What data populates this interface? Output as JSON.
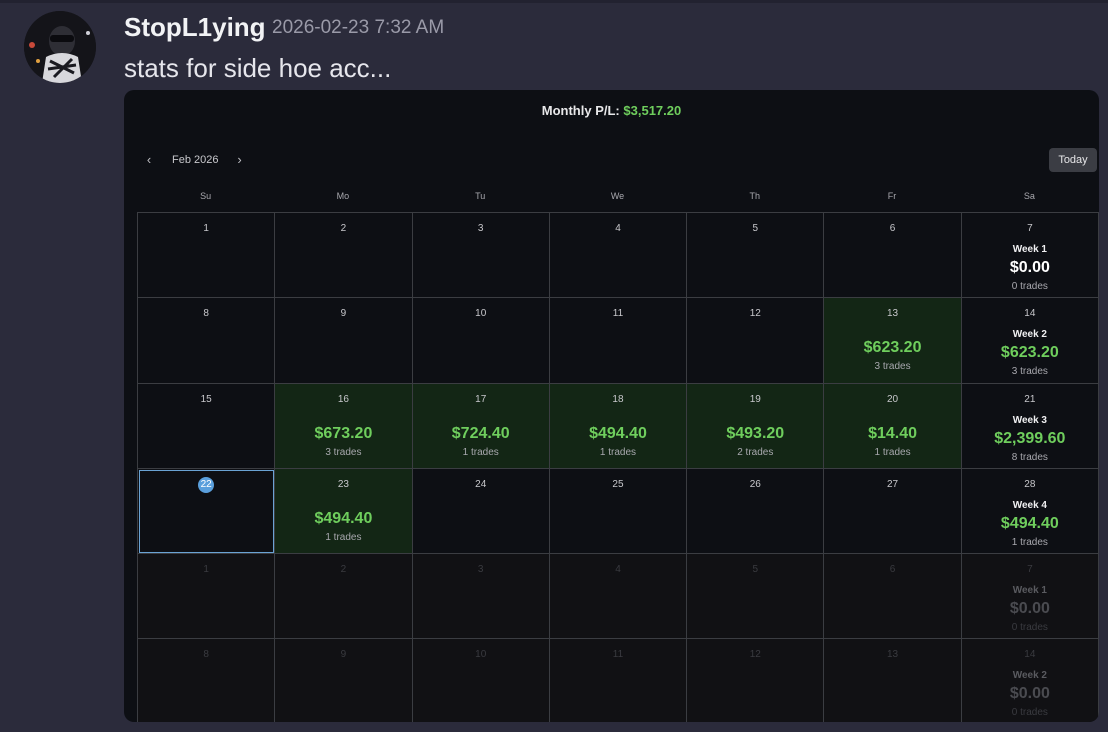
{
  "message": {
    "username": "StopL1ying",
    "timestamp": "2026-02-23 7:32 AM",
    "text": "stats for side hoe acc..."
  },
  "embed": {
    "monthly_label": "Monthly P/L:",
    "monthly_value": "$3,517.20",
    "month": "Feb 2026",
    "prev_icon": "chevron-left-icon",
    "next_icon": "chevron-right-icon",
    "today_label": "Today",
    "weekdays": [
      "Su",
      "Mo",
      "Tu",
      "We",
      "Th",
      "Fr",
      "Sa"
    ],
    "weeks": [
      {
        "days": [
          {
            "d": "1"
          },
          {
            "d": "2"
          },
          {
            "d": "3"
          },
          {
            "d": "4"
          },
          {
            "d": "5"
          },
          {
            "d": "6"
          },
          {
            "d": "7",
            "week": "Week 1",
            "amount": "$0.00",
            "trades": "0 trades",
            "zero": true
          }
        ]
      },
      {
        "days": [
          {
            "d": "8"
          },
          {
            "d": "9"
          },
          {
            "d": "10"
          },
          {
            "d": "11"
          },
          {
            "d": "12"
          },
          {
            "d": "13",
            "amount": "$623.20",
            "trades": "3 trades"
          },
          {
            "d": "14",
            "week": "Week 2",
            "amount": "$623.20",
            "trades": "3 trades"
          }
        ]
      },
      {
        "days": [
          {
            "d": "15"
          },
          {
            "d": "16",
            "amount": "$673.20",
            "trades": "3 trades"
          },
          {
            "d": "17",
            "amount": "$724.40",
            "trades": "1 trades"
          },
          {
            "d": "18",
            "amount": "$494.40",
            "trades": "1 trades"
          },
          {
            "d": "19",
            "amount": "$493.20",
            "trades": "2 trades"
          },
          {
            "d": "20",
            "amount": "$14.40",
            "trades": "1 trades"
          },
          {
            "d": "21",
            "week": "Week 3",
            "amount": "$2,399.60",
            "trades": "8 trades"
          }
        ]
      },
      {
        "days": [
          {
            "d": "22",
            "today": true
          },
          {
            "d": "23",
            "amount": "$494.40",
            "trades": "1 trades"
          },
          {
            "d": "24"
          },
          {
            "d": "25"
          },
          {
            "d": "26"
          },
          {
            "d": "27"
          },
          {
            "d": "28",
            "week": "Week 4",
            "amount": "$494.40",
            "trades": "1 trades"
          }
        ]
      },
      {
        "dim": true,
        "days": [
          {
            "d": "1"
          },
          {
            "d": "2"
          },
          {
            "d": "3"
          },
          {
            "d": "4"
          },
          {
            "d": "5"
          },
          {
            "d": "6"
          },
          {
            "d": "7",
            "week": "Week 1",
            "amount": "$0.00",
            "trades": "0 trades",
            "zero": true
          }
        ]
      },
      {
        "dim": true,
        "days": [
          {
            "d": "8"
          },
          {
            "d": "9"
          },
          {
            "d": "10"
          },
          {
            "d": "11"
          },
          {
            "d": "12"
          },
          {
            "d": "13"
          },
          {
            "d": "14",
            "week": "Week 2",
            "amount": "$0.00",
            "trades": "0 trades",
            "zero": true
          }
        ]
      }
    ]
  }
}
